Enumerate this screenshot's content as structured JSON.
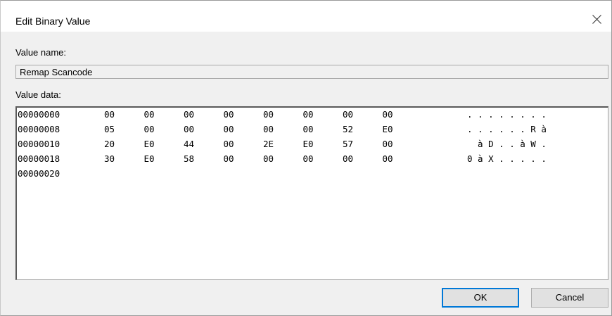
{
  "window": {
    "title": "Edit Binary Value"
  },
  "icons": {
    "close": "close-icon"
  },
  "value_name": {
    "label": "Value name:",
    "value": "Remap Scancode"
  },
  "value_data": {
    "label": "Value data:",
    "rows": [
      {
        "offset": "00000000",
        "bytes": [
          "00",
          "00",
          "00",
          "00",
          "00",
          "00",
          "00",
          "00"
        ],
        "ascii": ". . . . . . . ."
      },
      {
        "offset": "00000008",
        "bytes": [
          "05",
          "00",
          "00",
          "00",
          "00",
          "00",
          "52",
          "E0"
        ],
        "ascii": ". . . . . . R à"
      },
      {
        "offset": "00000010",
        "bytes": [
          "20",
          "E0",
          "44",
          "00",
          "2E",
          "E0",
          "57",
          "00"
        ],
        "ascii": "  à D . . à W ."
      },
      {
        "offset": "00000018",
        "bytes": [
          "30",
          "E0",
          "58",
          "00",
          "00",
          "00",
          "00",
          "00"
        ],
        "ascii": "0 à X . . . . ."
      },
      {
        "offset": "00000020",
        "bytes": [
          "",
          "",
          "",
          "",
          "",
          "",
          "",
          ""
        ],
        "ascii": ""
      }
    ]
  },
  "buttons": {
    "ok": "OK",
    "cancel": "Cancel"
  },
  "colors": {
    "accent": "#0078d7",
    "dialog_bg": "#f0f0f0"
  }
}
